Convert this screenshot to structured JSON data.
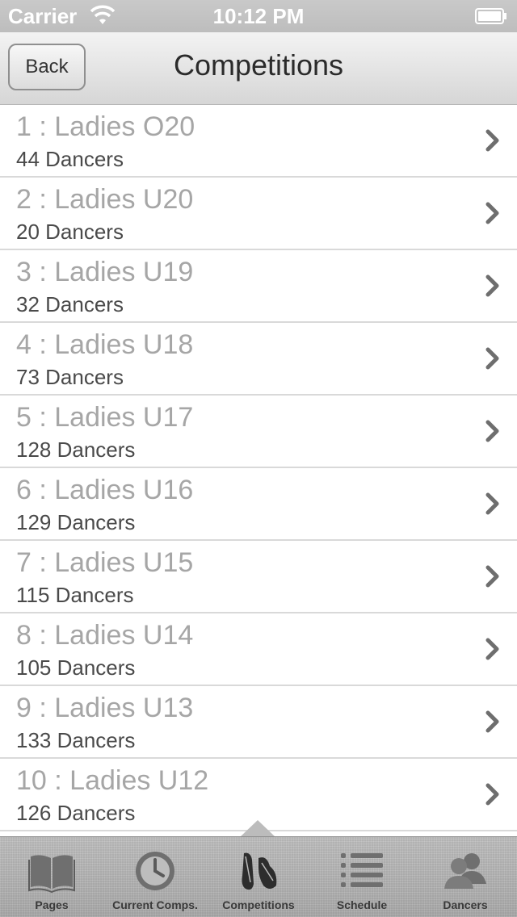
{
  "status_bar": {
    "carrier": "Carrier",
    "time": "10:12 PM"
  },
  "nav": {
    "back_label": "Back",
    "title": "Competitions"
  },
  "competitions": [
    {
      "title": "1 : Ladies O20",
      "subtitle": "44 Dancers"
    },
    {
      "title": "2 : Ladies U20",
      "subtitle": "20 Dancers"
    },
    {
      "title": "3 : Ladies U19",
      "subtitle": "32 Dancers"
    },
    {
      "title": "4 : Ladies U18",
      "subtitle": "73 Dancers"
    },
    {
      "title": "5 : Ladies U17",
      "subtitle": "128 Dancers"
    },
    {
      "title": "6 : Ladies U16",
      "subtitle": "129 Dancers"
    },
    {
      "title": "7 : Ladies U15",
      "subtitle": "115 Dancers"
    },
    {
      "title": "8 : Ladies U14",
      "subtitle": "105 Dancers"
    },
    {
      "title": "9 : Ladies U13",
      "subtitle": "133 Dancers"
    },
    {
      "title": "10 : Ladies U12",
      "subtitle": "126 Dancers"
    }
  ],
  "tab_bar": {
    "selected": "Competitions",
    "tabs": [
      {
        "label": "Pages",
        "icon": "book-icon"
      },
      {
        "label": "Current Comps.",
        "icon": "clock-icon"
      },
      {
        "label": "Competitions",
        "icon": "dance-shoes-icon"
      },
      {
        "label": "Schedule",
        "icon": "list-icon"
      },
      {
        "label": "Dancers",
        "icon": "people-icon"
      }
    ]
  }
}
